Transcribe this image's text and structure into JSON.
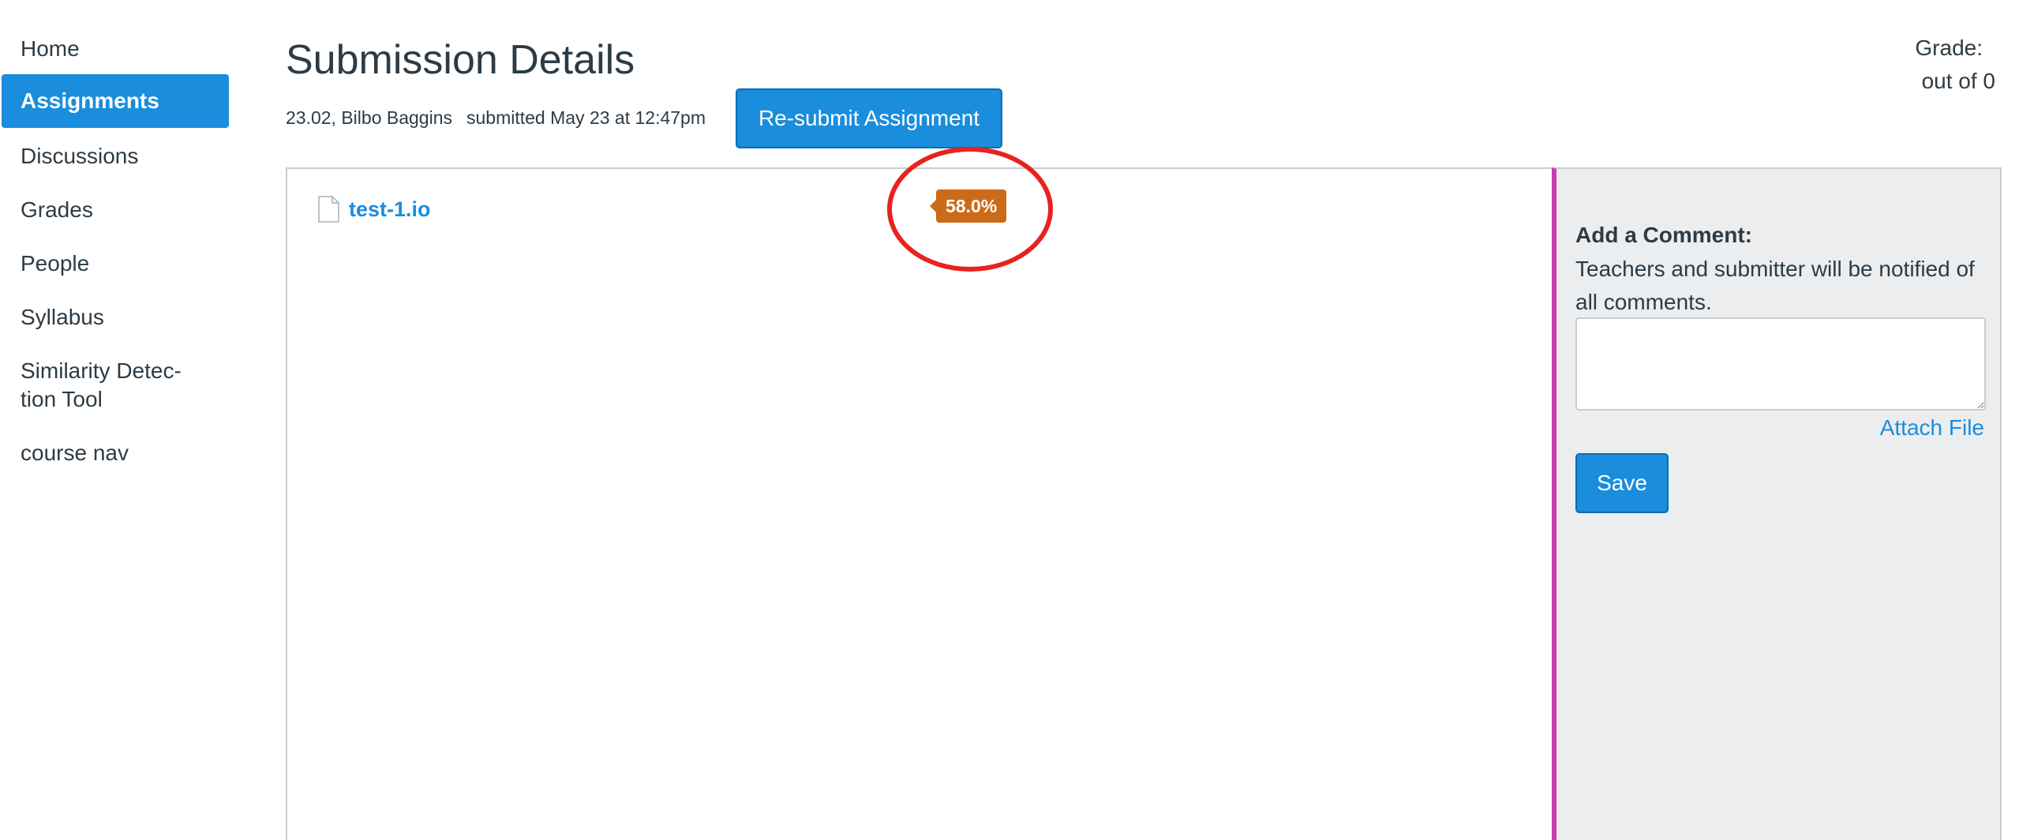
{
  "sidebar": {
    "items": [
      {
        "label": "Home",
        "active": false
      },
      {
        "label": "Assignments",
        "active": true
      },
      {
        "label": "Discussions",
        "active": false
      },
      {
        "label": "Grades",
        "active": false
      },
      {
        "label": "People",
        "active": false
      },
      {
        "label": "Syllabus",
        "active": false
      },
      {
        "label": "Similarity Detec-",
        "label2": "tion Tool",
        "active": false
      },
      {
        "label": "course nav",
        "active": false
      }
    ]
  },
  "header": {
    "title": "Submission Details",
    "submission_id_student": "23.02, Bilbo Baggins",
    "submitted_text": "submitted May 23 at 12:47pm",
    "resubmit_label": "Re-submit Assignment"
  },
  "grade": {
    "label": "Grade:",
    "value": "out of 0"
  },
  "submission": {
    "file_name": "test-1.io",
    "file_icon": "document-icon",
    "similarity_score": "58.0%"
  },
  "comment": {
    "title": "Add a Comment:",
    "help_text": "Teachers and submitter will be notified of all comments.",
    "input_value": "",
    "attach_label": "Attach File",
    "save_label": "Save"
  },
  "colors": {
    "accent": "#1a8ddd",
    "score_badge": "#cc6a1a",
    "highlight": "#e8221e",
    "panel_border": "#c83fb0"
  }
}
